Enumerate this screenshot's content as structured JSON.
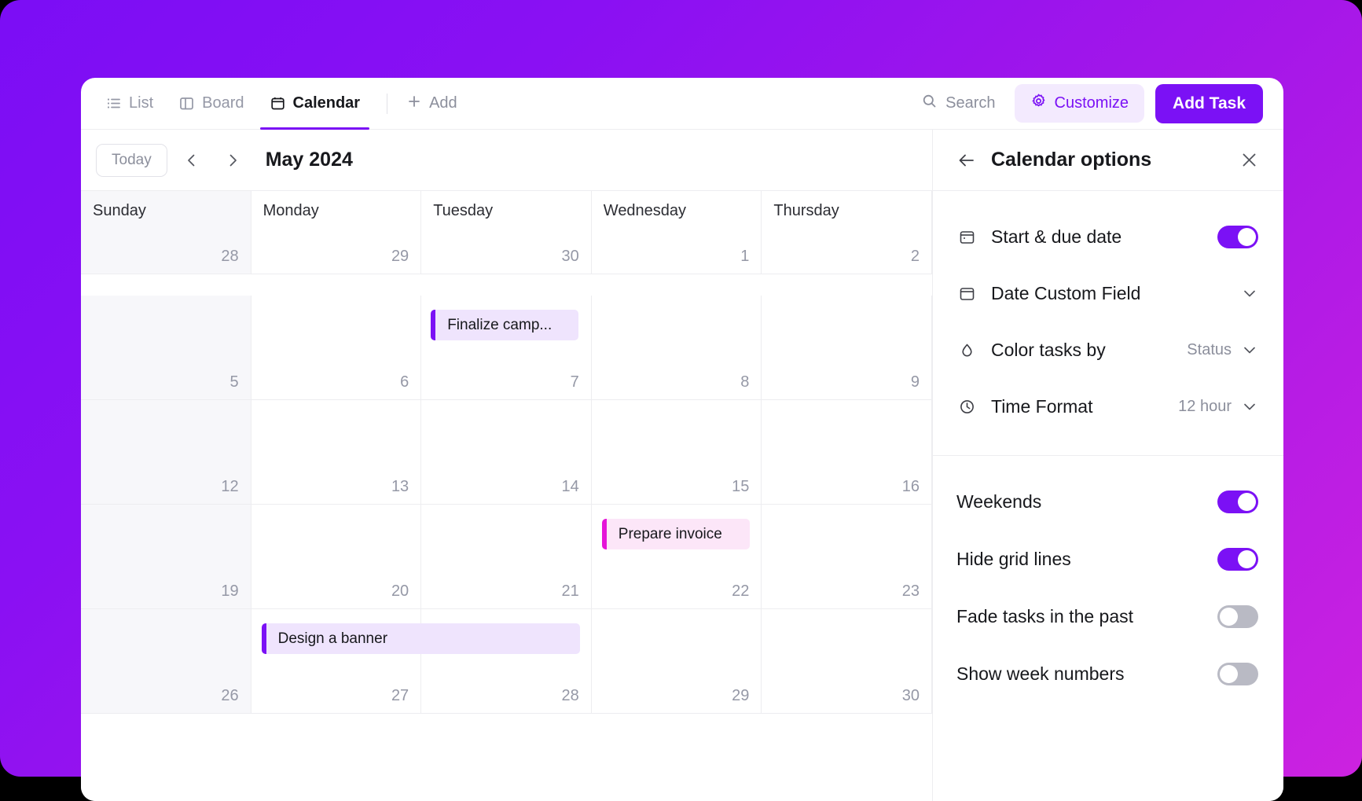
{
  "theme": {
    "accent": "#7B11F5",
    "accent_soft": "#F3EAFE",
    "event_purple_bg": "#EFE4FD",
    "event_purple_bar": "#7B11F5",
    "event_pink_bg": "#FCE6F8",
    "event_pink_bar": "#E515D8",
    "backdrop_from": "#7B0DF5",
    "backdrop_to": "#CC22E0",
    "weekend_bg": "#F7F7FA",
    "grid_line": "#EDEDF0",
    "muted_text": "#8C8F9C"
  },
  "toolbar": {
    "views": [
      {
        "label": "List",
        "icon": "list-icon",
        "active": false
      },
      {
        "label": "Board",
        "icon": "board-icon",
        "active": false
      },
      {
        "label": "Calendar",
        "icon": "calendar-icon",
        "active": true
      }
    ],
    "add_view_label": "Add",
    "add_view_icon": "plus-icon",
    "search_label": "Search",
    "search_icon": "search-icon",
    "customize_label": "Customize",
    "customize_icon": "gear-icon",
    "add_task_label": "Add Task"
  },
  "calendar_nav": {
    "today_label": "Today",
    "prev_icon": "chevron-left-icon",
    "next_icon": "chevron-right-icon",
    "month_label": "May 2024"
  },
  "calendar": {
    "day_headers": [
      "Sunday",
      "Monday",
      "Tuesday",
      "Wednesday",
      "Thursday"
    ],
    "weeks": [
      {
        "days": [
          {
            "num": "28",
            "weekend": true
          },
          {
            "num": "29",
            "weekend": false
          },
          {
            "num": "30",
            "weekend": false
          },
          {
            "num": "1",
            "weekend": false
          },
          {
            "num": "2",
            "weekend": false
          }
        ]
      },
      {
        "days": [
          {
            "num": "5",
            "weekend": true
          },
          {
            "num": "6",
            "weekend": false
          },
          {
            "num": "7",
            "weekend": false
          },
          {
            "num": "8",
            "weekend": false
          },
          {
            "num": "9",
            "weekend": false
          }
        ]
      },
      {
        "days": [
          {
            "num": "12",
            "weekend": true
          },
          {
            "num": "13",
            "weekend": false
          },
          {
            "num": "14",
            "weekend": false
          },
          {
            "num": "15",
            "weekend": false
          },
          {
            "num": "16",
            "weekend": false
          }
        ]
      },
      {
        "days": [
          {
            "num": "19",
            "weekend": true
          },
          {
            "num": "20",
            "weekend": false
          },
          {
            "num": "21",
            "weekend": false
          },
          {
            "num": "22",
            "weekend": false
          },
          {
            "num": "23",
            "weekend": false
          }
        ]
      },
      {
        "days": [
          {
            "num": "26",
            "weekend": true
          },
          {
            "num": "27",
            "weekend": false
          },
          {
            "num": "28",
            "weekend": false
          },
          {
            "num": "29",
            "weekend": false
          },
          {
            "num": "30",
            "weekend": false
          }
        ]
      }
    ],
    "events": [
      {
        "title": "Finalize camp...",
        "color": "purple"
      },
      {
        "title": "Prepare invoice",
        "color": "pink"
      },
      {
        "title": "Design a banner",
        "color": "purple"
      }
    ]
  },
  "panel": {
    "back_icon": "arrow-left-icon",
    "title": "Calendar options",
    "close_icon": "close-icon",
    "options": [
      {
        "label": "Start & due date",
        "icon": "calendar-icon",
        "control": "toggle",
        "state": "on"
      },
      {
        "label": "Date Custom Field",
        "icon": "calendar-icon",
        "control": "chevron"
      },
      {
        "label": "Color tasks by",
        "icon": "droplet-icon",
        "control": "select",
        "value": "Status"
      },
      {
        "label": "Time Format",
        "icon": "clock-icon",
        "control": "select",
        "value": "12 hour"
      }
    ],
    "toggles": [
      {
        "label": "Weekends",
        "state": "on"
      },
      {
        "label": "Hide grid lines",
        "state": "on"
      },
      {
        "label": "Fade tasks in the past",
        "state": "off"
      },
      {
        "label": "Show week numbers",
        "state": "off"
      }
    ]
  }
}
